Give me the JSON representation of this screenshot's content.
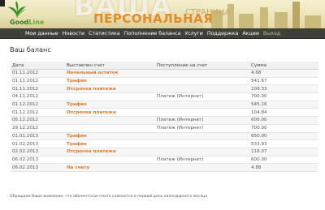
{
  "header": {
    "logo_text_dark": "Good",
    "logo_text_light": "Line",
    "title_big": "ВАША",
    "title_small": "СТРАНИЦА",
    "title_main": "ПЕРСОНАЛЬНАЯ",
    "colors": {
      "accent": "#e68a2a",
      "logo_green": "#2f7d1e",
      "nav_bg": "#3f4037"
    }
  },
  "nav": {
    "items": [
      "Мои данные",
      "Новости",
      "Статистика",
      "Пополнение баланса",
      "Услуги",
      "Поддержка",
      "Акции"
    ],
    "exit_label": "Выход"
  },
  "page": {
    "title": "Ваш баланс",
    "columns": {
      "date": "Дата",
      "charged": "Выставлен счет",
      "received": "Поступление на счет",
      "amount": "Сумма"
    },
    "rows": [
      {
        "date": "01.11.2012",
        "charged": "Начальный остаток",
        "received": "",
        "amount": "4.68"
      },
      {
        "date": "01.11.2012",
        "charged": "Трафик",
        "received": "",
        "amount": "541.67"
      },
      {
        "date": "01.11.2012",
        "charged": "Отсрочка платежа",
        "received": "",
        "amount": "108.33"
      },
      {
        "date": "04.11.2012",
        "charged": "",
        "received": "Платеж (Интернет)",
        "amount": "700.00"
      },
      {
        "date": "01.12.2012",
        "charged": "Трафик",
        "received": "",
        "amount": "545.16"
      },
      {
        "date": "01.12.2012",
        "charged": "Отсрочка платежа",
        "received": "",
        "amount": "104.84"
      },
      {
        "date": "05.12.2012",
        "charged": "",
        "received": "Платеж (Интернет)",
        "amount": "600.00"
      },
      {
        "date": "29.12.2012",
        "charged": "",
        "received": "Платеж (Интернет)",
        "amount": "700.00"
      },
      {
        "date": "01.01.2013",
        "charged": "Трафик",
        "received": "",
        "amount": "650.00"
      },
      {
        "date": "01.02.2013",
        "charged": "Трафик",
        "received": "",
        "amount": "533.93"
      },
      {
        "date": "02.02.2013",
        "charged": "Отсрочка платежа",
        "received": "",
        "amount": "116.07"
      },
      {
        "date": "06.02.2013",
        "charged": "",
        "received": "Платеж (Интернет)",
        "amount": "600.00"
      },
      {
        "date": "06.02.2013",
        "charged": "На счету",
        "received": "",
        "amount": "4.88"
      }
    ],
    "footnote": "Обращаем Ваше внимание, что абонентская плата снимается в первый день календарного месяца"
  }
}
